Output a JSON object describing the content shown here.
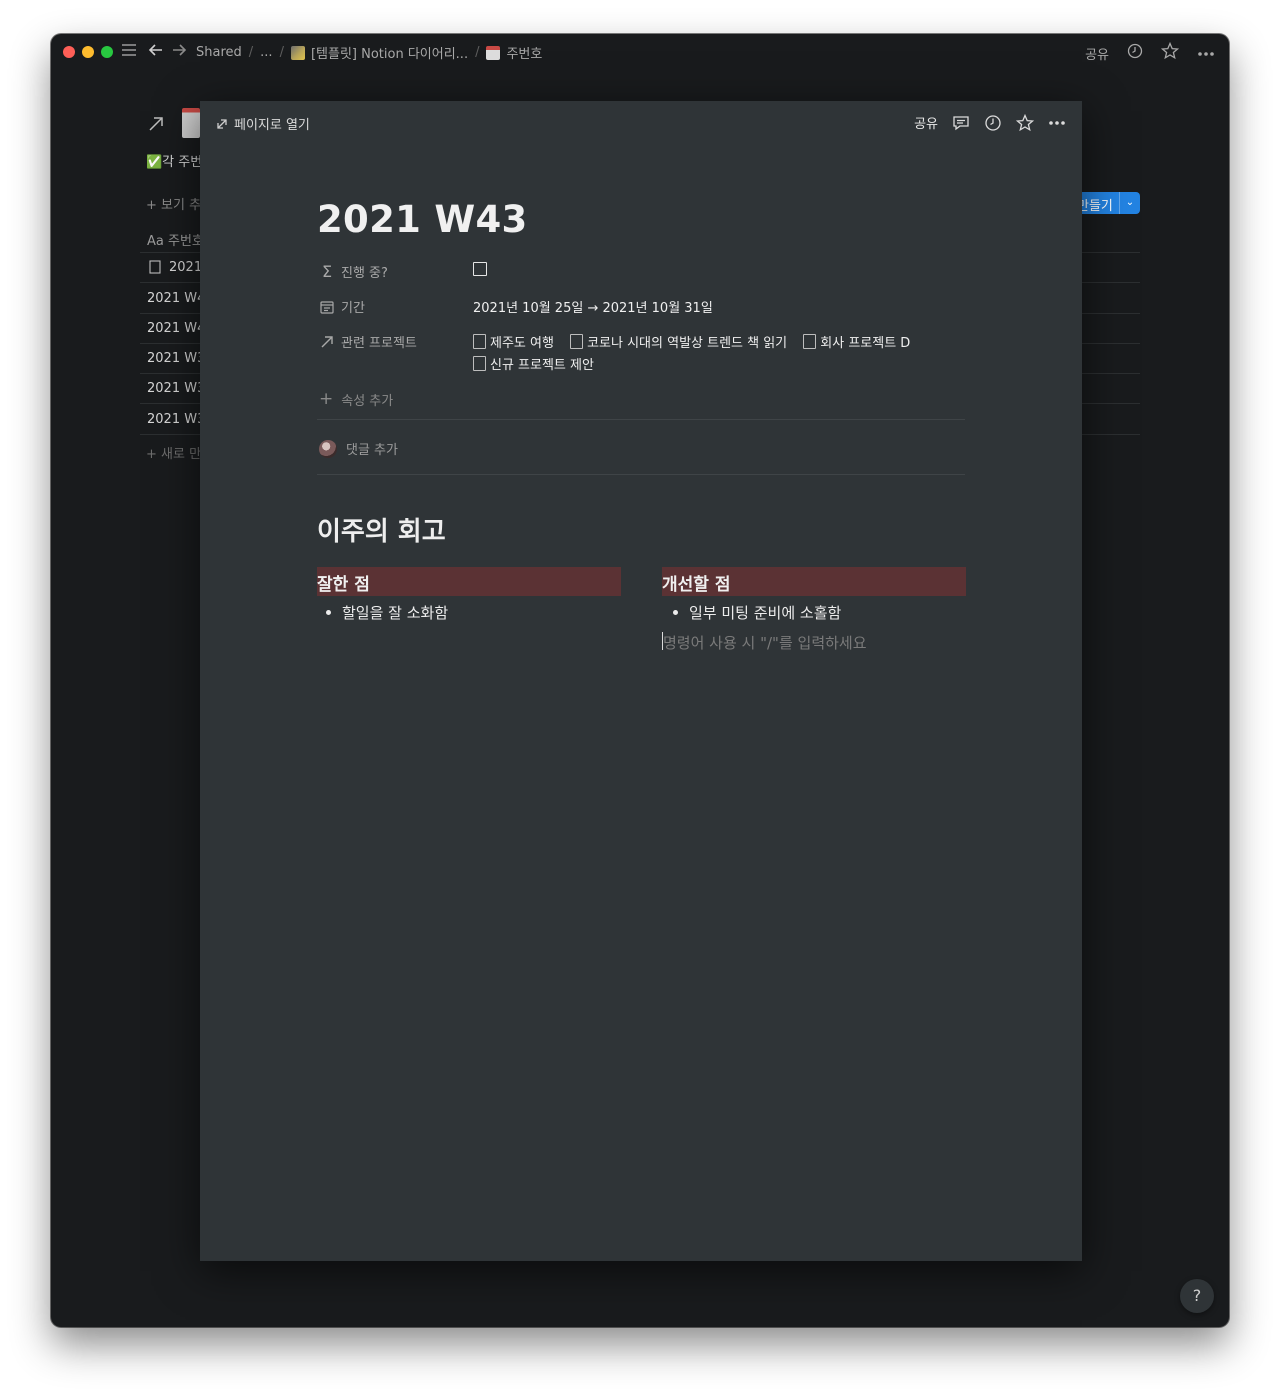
{
  "topbar": {
    "breadcrumbs": [
      {
        "label": "Shared"
      },
      {
        "label": "..."
      },
      {
        "label": "[템플릿] Notion 다이어리..."
      },
      {
        "label": "주번호"
      }
    ],
    "share_label": "공유"
  },
  "background_view": {
    "header_partial": "✅각 주번",
    "add_view_partial": "+ 보기 추",
    "column_header_partial": "Aa 주번호",
    "rows": [
      "2021",
      "2021 W4",
      "2021 W4",
      "2021 W3",
      "2021 W3",
      "2021 W3"
    ],
    "new_row_partial": "+ 새로 만",
    "new_button_partial": "만들기"
  },
  "modal": {
    "open_as_page_label": "페이지로 열기",
    "share_label": "공유",
    "title": "2021 W43",
    "properties": {
      "in_progress": {
        "label": "진행 중?",
        "checked": false
      },
      "period": {
        "label": "기간",
        "value": "2021년 10월 25일 → 2021년 10월 31일"
      },
      "related_projects": {
        "label": "관련 프로젝트",
        "items": [
          "제주도 여행",
          "코로나 시대의 역발상 트렌드 책 읽기",
          "회사 프로젝트 D",
          "신규 프로젝트 제안"
        ]
      }
    },
    "add_property_label": "속성 추가",
    "add_comment_label": "댓글 추가",
    "section_heading": "이주의 회고",
    "columns": [
      {
        "heading": "잘한 점",
        "bullets": [
          "할일을 잘 소화함"
        ]
      },
      {
        "heading": "개선할 점",
        "bullets": [
          "일부 미팅 준비에 소홀함"
        ],
        "placeholder": "명령어 사용 시 \"/\"를 입력하세요"
      }
    ]
  },
  "help_label": "?",
  "colors": {
    "window_bg": "#191b1d",
    "modal_bg": "#2f3437",
    "heading_highlight": "#5b3234",
    "accent_blue": "#2383e2"
  }
}
